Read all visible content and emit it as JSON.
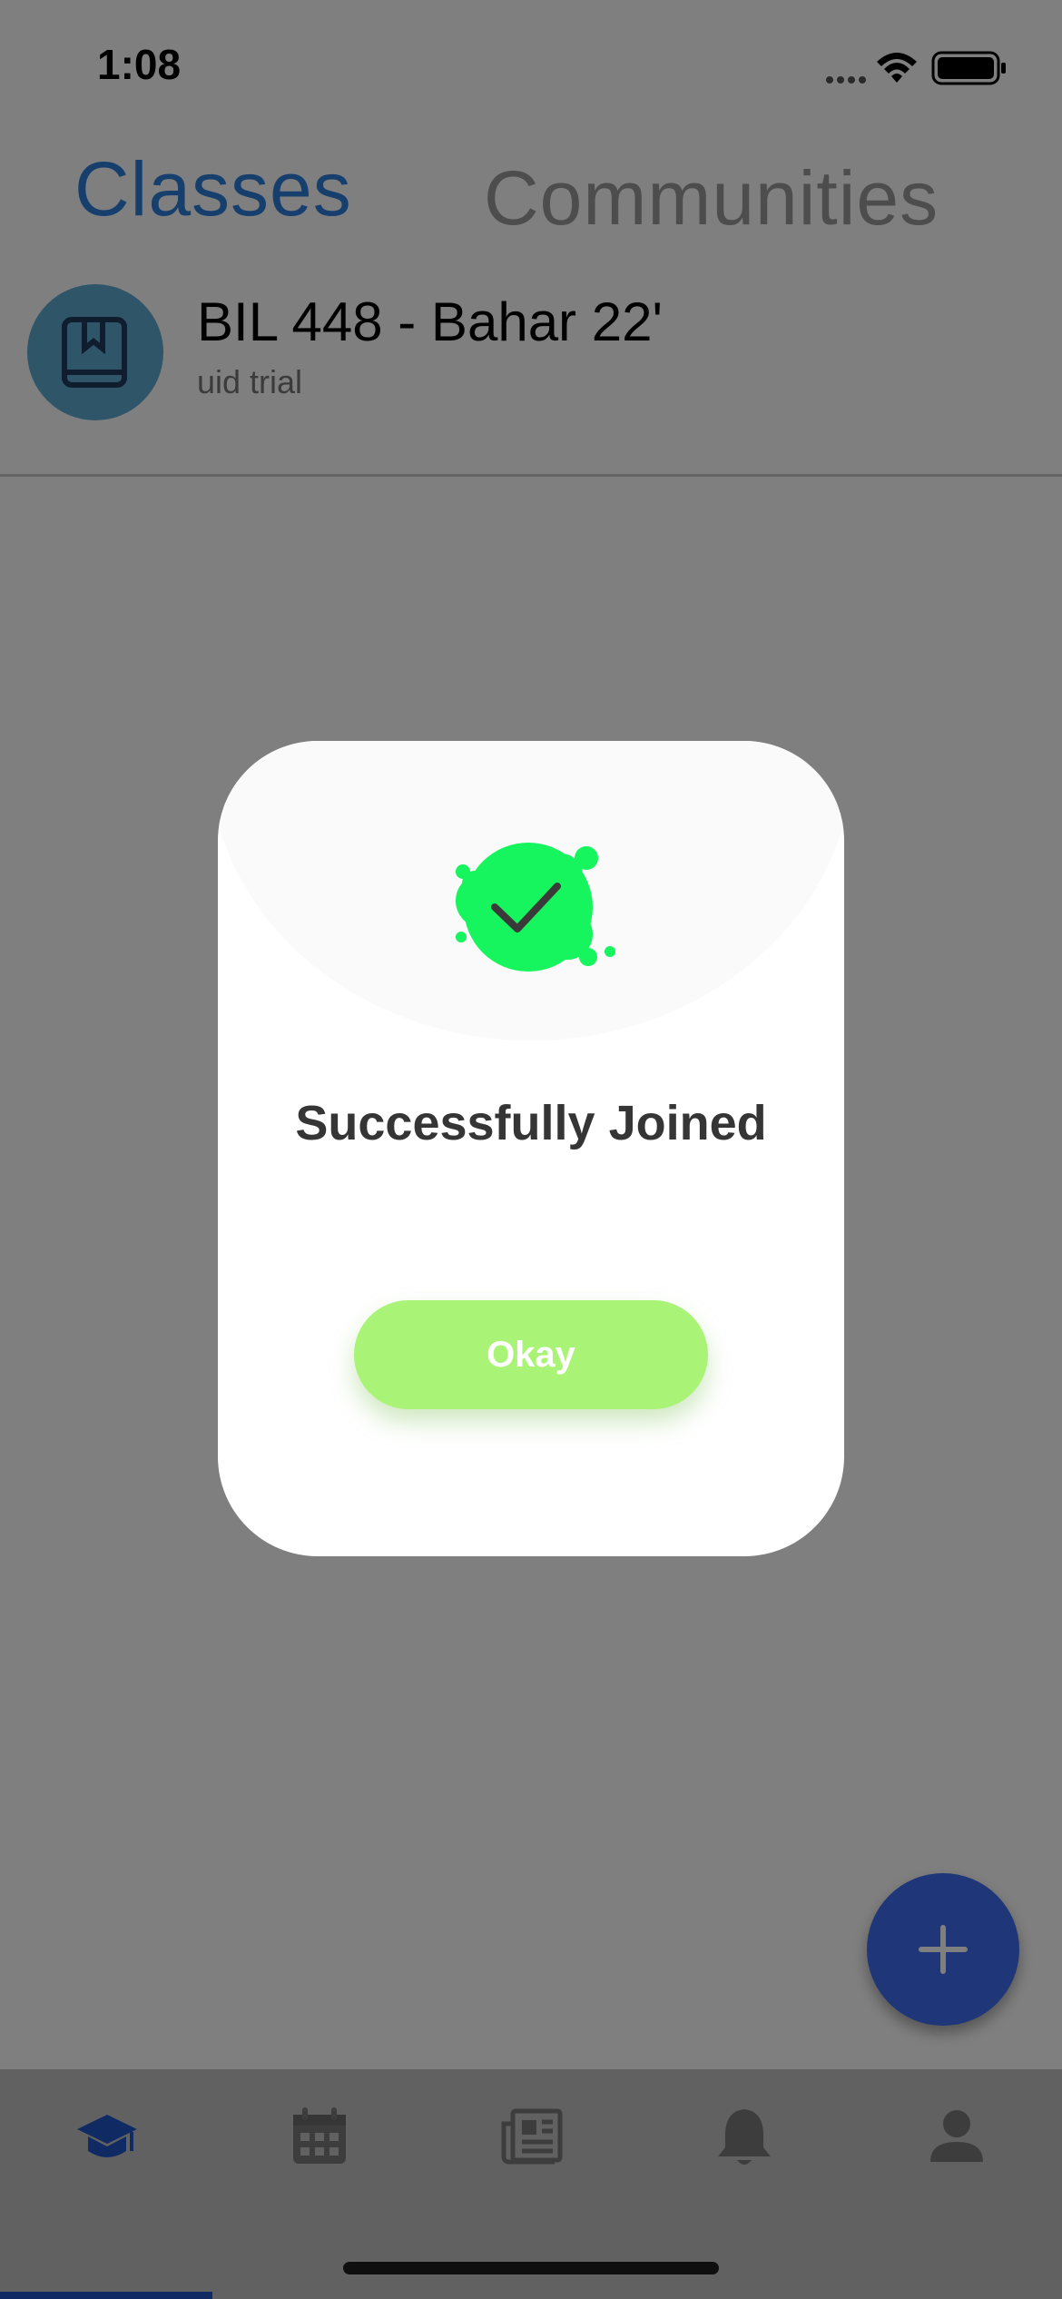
{
  "status_bar": {
    "time": "1:08"
  },
  "tabs": [
    {
      "label": "Classes",
      "active": true
    },
    {
      "label": "Communities",
      "active": false
    }
  ],
  "classes": [
    {
      "title": "BIL 448 - Bahar 22'",
      "subtitle": "uid trial",
      "icon": "book-icon"
    }
  ],
  "dialog": {
    "title": "Successfully Joined",
    "button_label": "Okay",
    "icon": "success-check-icon"
  },
  "bottom_nav": [
    {
      "icon": "graduation-cap-icon",
      "active": true
    },
    {
      "icon": "calendar-icon",
      "active": false
    },
    {
      "icon": "newspaper-icon",
      "active": false
    },
    {
      "icon": "bell-icon",
      "active": false
    },
    {
      "icon": "person-icon",
      "active": false
    }
  ],
  "colors": {
    "accent": "#2f7fda",
    "fab": "#3f6ff0",
    "success_green": "#17f55e",
    "okay_button": "#a9f476"
  }
}
